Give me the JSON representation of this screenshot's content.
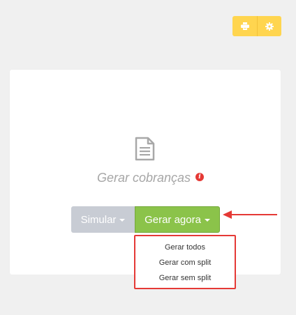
{
  "toolbar": {
    "print_icon": "print-icon",
    "settings_icon": "gear-icon",
    "color": "#ffd54f"
  },
  "main": {
    "icon": "document-icon",
    "title": "Gerar cobranças",
    "info_icon": "info-icon",
    "info_glyph": "i"
  },
  "actions": {
    "simular_label": "Simular",
    "gerar_agora_label": "Gerar agora",
    "simular_color": "#c8ccd4",
    "gerar_color": "#8bc34a"
  },
  "dropdown": {
    "items": [
      {
        "label": "Gerar todos"
      },
      {
        "label": "Gerar com split"
      },
      {
        "label": "Gerar sem split"
      }
    ],
    "highlight_color": "#e53935"
  },
  "annotation": {
    "arrow_color": "#e53935"
  }
}
